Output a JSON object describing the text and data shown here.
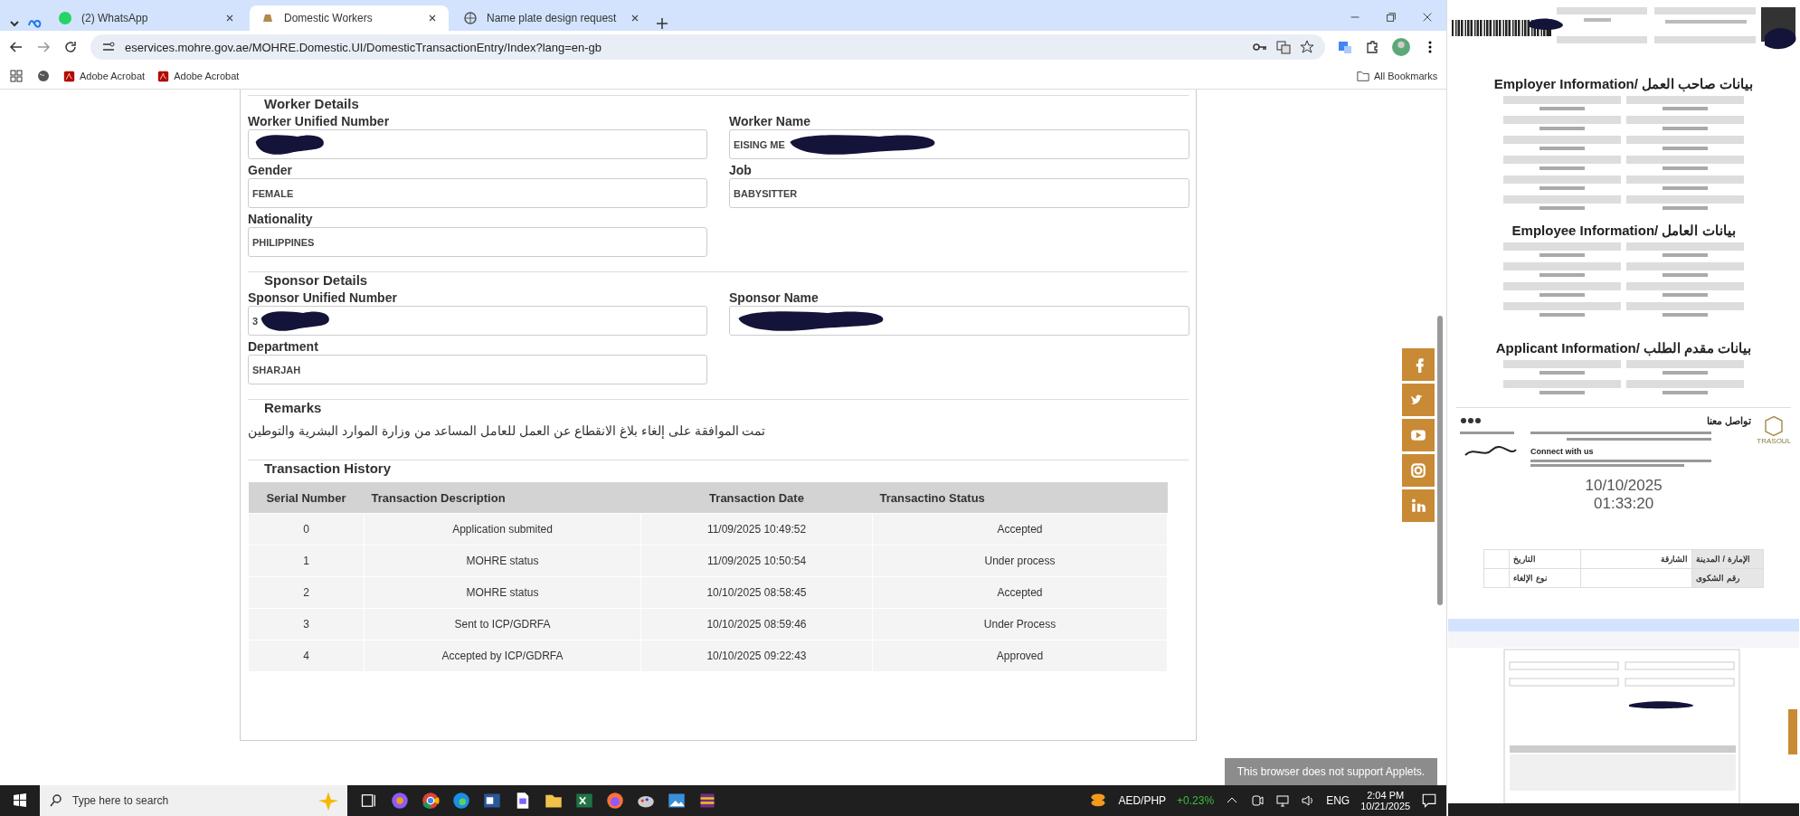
{
  "browser": {
    "tabs": [
      {
        "label": "(2) WhatsApp",
        "selected": false
      },
      {
        "label": "Domestic Workers",
        "selected": true
      },
      {
        "label": "Name plate design request",
        "selected": false
      }
    ],
    "url": "eservices.mohre.gov.ae/MOHRE.Domestic.UI/DomesticTransactionEntry/Index?lang=en-gb",
    "bookmarks": [
      "Adobe Acrobat",
      "Adobe Acrobat"
    ],
    "all_bookmarks": "All Bookmarks"
  },
  "sections": [
    {
      "title": "Worker Details",
      "fields": [
        {
          "label": "Worker Unified Number",
          "redacted": true
        },
        {
          "label": "Worker Name",
          "value": "EISING ME",
          "redacted": true
        },
        {
          "label": "Gender",
          "value": "FEMALE",
          "redacted": false
        },
        {
          "label": "Job",
          "value": "BABYSITTER",
          "redacted": false
        },
        {
          "label": "Nationality",
          "value": "PHILIPPINES",
          "redacted": false
        }
      ]
    },
    {
      "title": "Sponsor Details",
      "fields": [
        {
          "label": "Sponsor Unified Number",
          "value": "3",
          "redacted": true
        },
        {
          "label": "Sponsor Name",
          "redacted": true
        },
        {
          "label": "Department",
          "value": "SHARJAH",
          "redacted": false
        }
      ]
    }
  ],
  "remarks": {
    "title": "Remarks",
    "text": "تمت الموافقة على إلغاء بلاغ الانقطاع عن العمل للعامل المساعد من وزارة الموارد البشرية والتوطين"
  },
  "history": {
    "title": "Transaction History",
    "columns": [
      "Serial Number",
      "Transaction Description",
      "Transaction Date",
      "Transactino Status"
    ],
    "rows": [
      [
        "0",
        "Application submited",
        "11/09/2025 10:49:52",
        "Accepted"
      ],
      [
        "1",
        "MOHRE status",
        "11/09/2025 10:50:54",
        "Under process"
      ],
      [
        "2",
        "MOHRE status",
        "10/10/2025 08:58:45",
        "Accepted"
      ],
      [
        "3",
        "Sent to ICP/GDRFA",
        "10/10/2025 08:59:46",
        "Under Process"
      ],
      [
        "4",
        "Accepted by ICP/GDRFA",
        "10/10/2025 09:22:43",
        "Approved"
      ]
    ]
  },
  "tooltip": "This browser does not support Applets.",
  "taskbar": {
    "search_placeholder": "Type here to search",
    "ticker": "AED/PHP",
    "ticker_change": "+0.23%",
    "language": "ENG",
    "time": "2:04 PM",
    "date": "10/21/2025"
  },
  "document": {
    "headings": [
      "Employer Information/ بيانات صاحب العمل",
      "Employee Information/ بيانات العامل",
      "Applicant Information/ بيانات مقدم الطلب"
    ],
    "contact_title": "تواصل معنا",
    "connect_title": "Connect with us",
    "brand": "TRASOUL",
    "date": "10/10/2025",
    "time": "01:33:20",
    "table": [
      [
        {
          "label": "الإمارة / المدينة",
          "value": "الشارقة"
        },
        {
          "label": "التاريخ"
        }
      ],
      [
        {
          "label": "رقم الشكوى"
        },
        {
          "label": "نوع الإلغاء"
        }
      ]
    ]
  }
}
